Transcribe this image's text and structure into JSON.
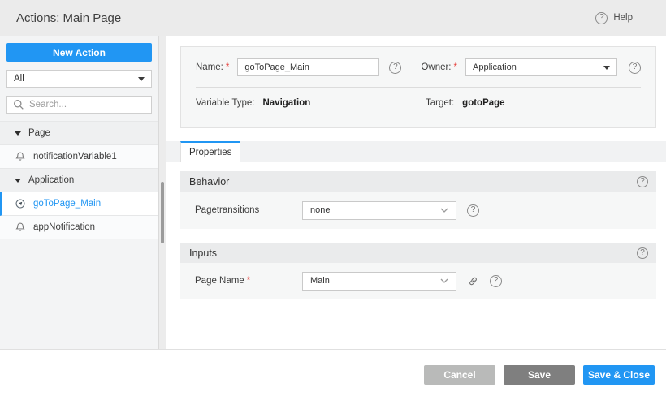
{
  "header": {
    "title": "Actions: Main Page",
    "help_label": "Help"
  },
  "sidebar": {
    "new_action_label": "New Action",
    "filter_value": "All",
    "search_placeholder": "Search...",
    "tree": [
      {
        "type": "group",
        "label": "Page"
      },
      {
        "type": "item",
        "icon": "notification-icon",
        "label": "notificationVariable1"
      },
      {
        "type": "group",
        "label": "Application"
      },
      {
        "type": "item",
        "icon": "goto-page-icon",
        "label": "goToPage_Main",
        "selected": true
      },
      {
        "type": "item",
        "icon": "notification-icon",
        "label": "appNotification"
      }
    ]
  },
  "form": {
    "name_label": "Name:",
    "name_value": "goToPage_Main",
    "owner_label": "Owner:",
    "owner_value": "Application",
    "variable_type_label": "Variable Type:",
    "variable_type_value": "Navigation",
    "target_label": "Target:",
    "target_value": "gotoPage"
  },
  "tabs": {
    "properties_label": "Properties"
  },
  "sections": {
    "behavior": {
      "title": "Behavior",
      "row": {
        "label": "Pagetransitions",
        "value": "none"
      }
    },
    "inputs": {
      "title": "Inputs",
      "row": {
        "label": "Page Name",
        "value": "Main"
      }
    }
  },
  "footer": {
    "cancel_label": "Cancel",
    "save_label": "Save",
    "save_close_label": "Save & Close"
  },
  "misc": {
    "required_mark": "*",
    "question_glyph": "?"
  },
  "colors": {
    "accent_blue": "#2196f3",
    "save_gray": "#7f7f7f",
    "cancel_gray": "#b9bab9",
    "required_red": "#e53935",
    "header_bg": "#ebebeb",
    "panel_bg": "#f6f7f7",
    "section_header_bg": "#eaebec"
  }
}
